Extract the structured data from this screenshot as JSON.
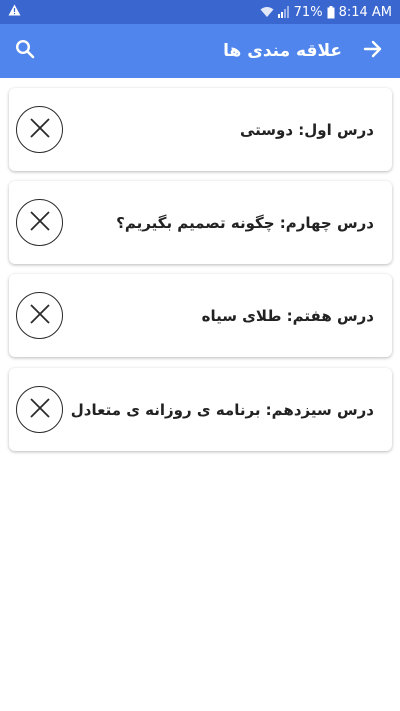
{
  "status_bar": {
    "alert_icon": "warning-triangle-icon",
    "battery_percent": "71%",
    "time": "8:14 AM"
  },
  "app_bar": {
    "title": "علاقه مندی ها",
    "search_icon": "search-icon",
    "back_icon": "arrow-forward-icon"
  },
  "favorites": [
    {
      "title": "درس اول: دوستی"
    },
    {
      "title": "درس چهارم: چگونه تصمیم بگیریم؟"
    },
    {
      "title": "درس هفتم: طلای سیاه"
    },
    {
      "title": "درس سیزدهم: برنامه ی روزانه ی متعادل"
    }
  ],
  "colors": {
    "status_bar": "#3a66cf",
    "app_bar": "#4f85ec",
    "background": "#ffffff"
  }
}
